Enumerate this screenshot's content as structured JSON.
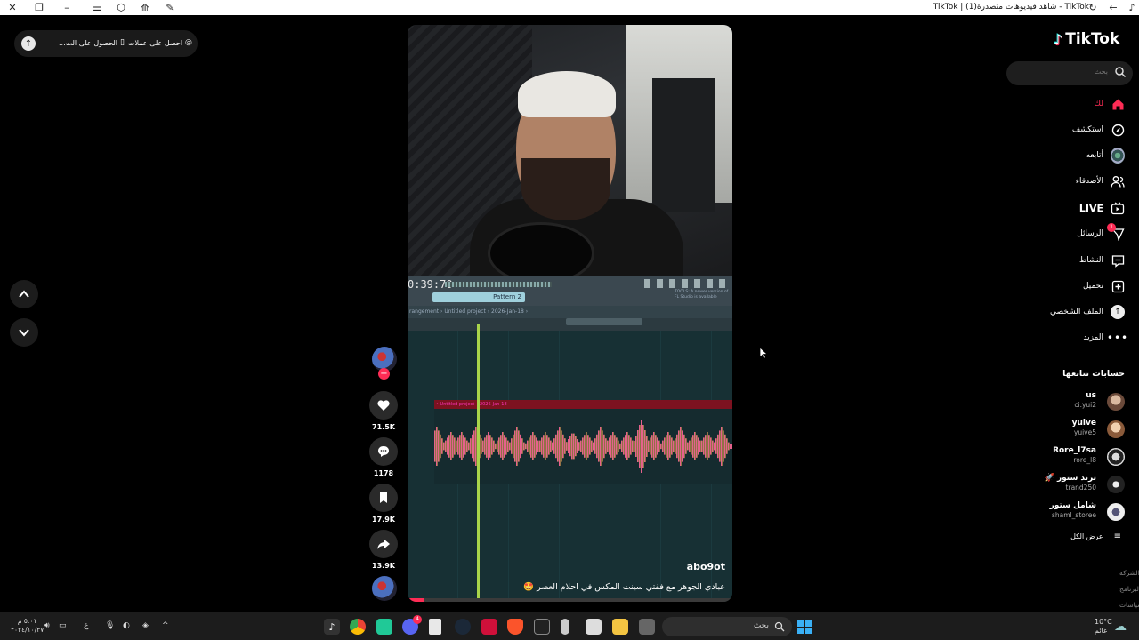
{
  "titlebar": {
    "title": "TikTok - شاهد فيديوهات متصدرة(1) | TikTok"
  },
  "coins_pill": {
    "get_coins": "احصل على عملات",
    "get_app": "الحصول على الت..."
  },
  "video": {
    "daw_time": "0:39:70",
    "pattern_label": "Pattern 2",
    "daw_hint": "TOOLS: A newer version of FL Studio is available",
    "daw_breadcrumb": "rangement › Untitled project › 2026-Jan-18 ›",
    "clip_title": "• Untitled project – 2026-Jan-18",
    "username": "abo9ot",
    "caption": "عبادي الجوهر مع ففتي سينت المكس في احلام العصر 🤩",
    "progress": 0.05
  },
  "actions": {
    "likes": "71.5K",
    "comments": "1178",
    "saves": "17.9K",
    "shares": "13.9K"
  },
  "sidebar": {
    "logo": "TikTok",
    "search_placeholder": "بحث",
    "nav": [
      {
        "label": "لك",
        "icon": "home-icon"
      },
      {
        "label": "استكشف",
        "icon": "compass-icon"
      },
      {
        "label": "أتابعه",
        "icon": "following-avatar-icon"
      },
      {
        "label": "الأصدقاء",
        "icon": "friends-icon"
      },
      {
        "label": "LIVE",
        "icon": "live-icon"
      },
      {
        "label": "الرسائل",
        "icon": "messages-icon"
      },
      {
        "label": "النشاط",
        "icon": "activity-icon"
      },
      {
        "label": "تحميل",
        "icon": "upload-icon"
      },
      {
        "label": "الملف الشخصي",
        "icon": "profile-icon"
      },
      {
        "label": "المزيد",
        "icon": "more-icon"
      }
    ],
    "messages_badge": "1",
    "following_title": "حسابات تتابعها",
    "accounts": [
      {
        "name": "us",
        "handle": "ci.yui2"
      },
      {
        "name": "yuive",
        "handle": "yuive5"
      },
      {
        "name": "Rore_l7sa",
        "handle": "rore_l8"
      },
      {
        "name": "ترند ستور 🚀",
        "handle": "trand250"
      },
      {
        "name": "شامل ستور",
        "handle": "shaml_storee"
      }
    ],
    "see_all": "عرض الكل",
    "footer": [
      "الشركة",
      "البرنامج",
      "الشروط والسياسات"
    ]
  },
  "taskbar": {
    "search_placeholder": "بحث",
    "time": "٥:٠١ م",
    "date": "٢٠٢٤/١٠/٢٧",
    "lang": "ع",
    "weather_temp": "10°C",
    "weather_desc": "غائم",
    "discord_badge": "4"
  }
}
